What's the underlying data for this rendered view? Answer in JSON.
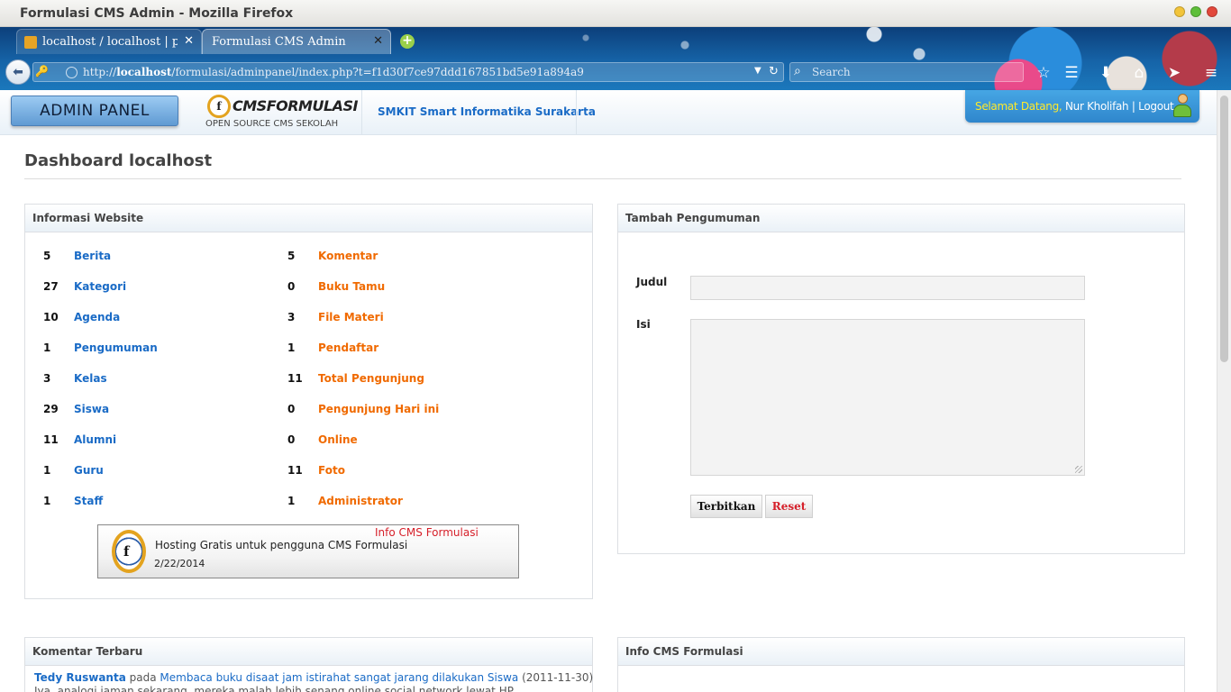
{
  "window": {
    "title": "Formulasi CMS Admin - Mozilla Firefox"
  },
  "browser": {
    "tabs": [
      {
        "label": "localhost / localhost | p...",
        "active": false
      },
      {
        "label": "Formulasi CMS Admin",
        "active": true
      }
    ],
    "url_prefix": "http://",
    "url_host": "localhost",
    "url_path": "/formulasi/adminpanel/index.php?t=f1d30f7ce97ddd167851bd5e91a894a9",
    "search_placeholder": "Search"
  },
  "header": {
    "admin_button": "ADMIN PANEL",
    "logo_brand": "CMSFORMULASI",
    "logo_tagline": "OPEN SOURCE CMS SEKOLAH",
    "school_name": "SMKIT Smart Informatika Surakarta",
    "greeting": "Selamat Datang,",
    "user_name": "Nur Kholifah",
    "separator": "|",
    "logout": "Logout"
  },
  "page": {
    "title": "Dashboard localhost"
  },
  "info_website": {
    "title": "Informasi Website",
    "left": [
      {
        "count": "5",
        "label": "Berita"
      },
      {
        "count": "27",
        "label": "Kategori"
      },
      {
        "count": "10",
        "label": "Agenda"
      },
      {
        "count": "1",
        "label": "Pengumuman"
      },
      {
        "count": "3",
        "label": "Kelas"
      },
      {
        "count": "29",
        "label": "Siswa"
      },
      {
        "count": "11",
        "label": "Alumni"
      },
      {
        "count": "1",
        "label": "Guru"
      },
      {
        "count": "1",
        "label": "Staff"
      }
    ],
    "right": [
      {
        "count": "5",
        "label": "Komentar"
      },
      {
        "count": "0",
        "label": "Buku Tamu"
      },
      {
        "count": "3",
        "label": "File Materi"
      },
      {
        "count": "1",
        "label": "Pendaftar"
      },
      {
        "count": "11",
        "label": "Total Pengunjung"
      },
      {
        "count": "0",
        "label": "Pengunjung Hari ini"
      },
      {
        "count": "0",
        "label": "Online"
      },
      {
        "count": "11",
        "label": "Foto"
      },
      {
        "count": "1",
        "label": "Administrator"
      }
    ],
    "news_box": {
      "tag": "Info CMS Formulasi",
      "headline": "Hosting Gratis untuk pengguna CMS Formulasi",
      "date": "2/22/2014"
    }
  },
  "announcement": {
    "title": "Tambah Pengumuman",
    "judul_label": "Judul",
    "isi_label": "Isi",
    "judul_value": "",
    "isi_value": "",
    "publish_button": "Terbitkan",
    "reset_button": "Reset"
  },
  "comments": {
    "title": "Komentar Terbaru",
    "items": [
      {
        "author": "Tedy Ruswanta",
        "connector": "pada",
        "topic": "Membaca buku disaat jam istirahat sangat jarang dilakukan Siswa",
        "date": "(2011-11-30)",
        "excerpt": "Iya, analogi jaman sekarang, mereka malah lebih senang online social network lewat HP"
      }
    ]
  },
  "info_cms": {
    "title": "Info CMS Formulasi"
  }
}
